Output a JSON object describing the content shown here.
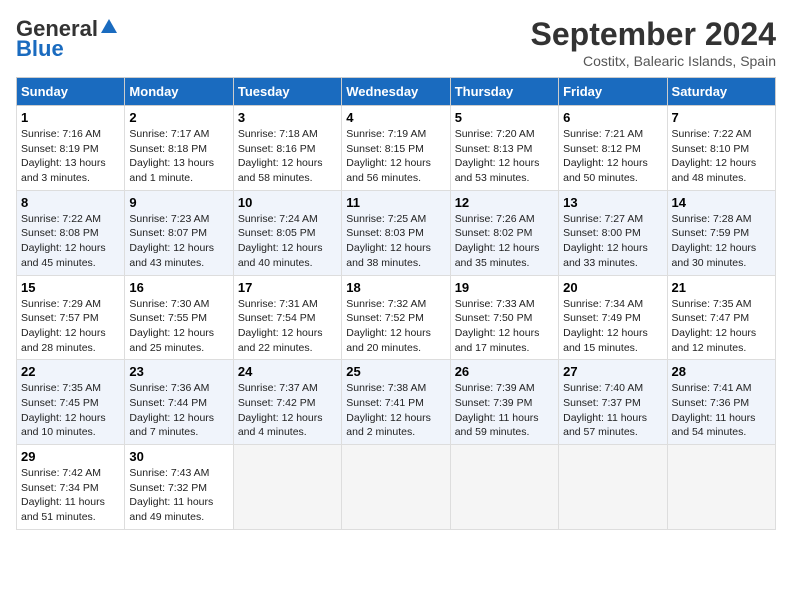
{
  "header": {
    "logo_general": "General",
    "logo_blue": "Blue",
    "title": "September 2024",
    "subtitle": "Costitx, Balearic Islands, Spain"
  },
  "columns": [
    "Sunday",
    "Monday",
    "Tuesday",
    "Wednesday",
    "Thursday",
    "Friday",
    "Saturday"
  ],
  "weeks": [
    [
      {
        "day": "1",
        "sunrise": "7:16 AM",
        "sunset": "8:19 PM",
        "daylight": "13 hours and 3 minutes."
      },
      {
        "day": "2",
        "sunrise": "7:17 AM",
        "sunset": "8:18 PM",
        "daylight": "13 hours and 1 minute."
      },
      {
        "day": "3",
        "sunrise": "7:18 AM",
        "sunset": "8:16 PM",
        "daylight": "12 hours and 58 minutes."
      },
      {
        "day": "4",
        "sunrise": "7:19 AM",
        "sunset": "8:15 PM",
        "daylight": "12 hours and 56 minutes."
      },
      {
        "day": "5",
        "sunrise": "7:20 AM",
        "sunset": "8:13 PM",
        "daylight": "12 hours and 53 minutes."
      },
      {
        "day": "6",
        "sunrise": "7:21 AM",
        "sunset": "8:12 PM",
        "daylight": "12 hours and 50 minutes."
      },
      {
        "day": "7",
        "sunrise": "7:22 AM",
        "sunset": "8:10 PM",
        "daylight": "12 hours and 48 minutes."
      }
    ],
    [
      {
        "day": "8",
        "sunrise": "7:22 AM",
        "sunset": "8:08 PM",
        "daylight": "12 hours and 45 minutes."
      },
      {
        "day": "9",
        "sunrise": "7:23 AM",
        "sunset": "8:07 PM",
        "daylight": "12 hours and 43 minutes."
      },
      {
        "day": "10",
        "sunrise": "7:24 AM",
        "sunset": "8:05 PM",
        "daylight": "12 hours and 40 minutes."
      },
      {
        "day": "11",
        "sunrise": "7:25 AM",
        "sunset": "8:03 PM",
        "daylight": "12 hours and 38 minutes."
      },
      {
        "day": "12",
        "sunrise": "7:26 AM",
        "sunset": "8:02 PM",
        "daylight": "12 hours and 35 minutes."
      },
      {
        "day": "13",
        "sunrise": "7:27 AM",
        "sunset": "8:00 PM",
        "daylight": "12 hours and 33 minutes."
      },
      {
        "day": "14",
        "sunrise": "7:28 AM",
        "sunset": "7:59 PM",
        "daylight": "12 hours and 30 minutes."
      }
    ],
    [
      {
        "day": "15",
        "sunrise": "7:29 AM",
        "sunset": "7:57 PM",
        "daylight": "12 hours and 28 minutes."
      },
      {
        "day": "16",
        "sunrise": "7:30 AM",
        "sunset": "7:55 PM",
        "daylight": "12 hours and 25 minutes."
      },
      {
        "day": "17",
        "sunrise": "7:31 AM",
        "sunset": "7:54 PM",
        "daylight": "12 hours and 22 minutes."
      },
      {
        "day": "18",
        "sunrise": "7:32 AM",
        "sunset": "7:52 PM",
        "daylight": "12 hours and 20 minutes."
      },
      {
        "day": "19",
        "sunrise": "7:33 AM",
        "sunset": "7:50 PM",
        "daylight": "12 hours and 17 minutes."
      },
      {
        "day": "20",
        "sunrise": "7:34 AM",
        "sunset": "7:49 PM",
        "daylight": "12 hours and 15 minutes."
      },
      {
        "day": "21",
        "sunrise": "7:35 AM",
        "sunset": "7:47 PM",
        "daylight": "12 hours and 12 minutes."
      }
    ],
    [
      {
        "day": "22",
        "sunrise": "7:35 AM",
        "sunset": "7:45 PM",
        "daylight": "12 hours and 10 minutes."
      },
      {
        "day": "23",
        "sunrise": "7:36 AM",
        "sunset": "7:44 PM",
        "daylight": "12 hours and 7 minutes."
      },
      {
        "day": "24",
        "sunrise": "7:37 AM",
        "sunset": "7:42 PM",
        "daylight": "12 hours and 4 minutes."
      },
      {
        "day": "25",
        "sunrise": "7:38 AM",
        "sunset": "7:41 PM",
        "daylight": "12 hours and 2 minutes."
      },
      {
        "day": "26",
        "sunrise": "7:39 AM",
        "sunset": "7:39 PM",
        "daylight": "11 hours and 59 minutes."
      },
      {
        "day": "27",
        "sunrise": "7:40 AM",
        "sunset": "7:37 PM",
        "daylight": "11 hours and 57 minutes."
      },
      {
        "day": "28",
        "sunrise": "7:41 AM",
        "sunset": "7:36 PM",
        "daylight": "11 hours and 54 minutes."
      }
    ],
    [
      {
        "day": "29",
        "sunrise": "7:42 AM",
        "sunset": "7:34 PM",
        "daylight": "11 hours and 51 minutes."
      },
      {
        "day": "30",
        "sunrise": "7:43 AM",
        "sunset": "7:32 PM",
        "daylight": "11 hours and 49 minutes."
      },
      null,
      null,
      null,
      null,
      null
    ]
  ]
}
